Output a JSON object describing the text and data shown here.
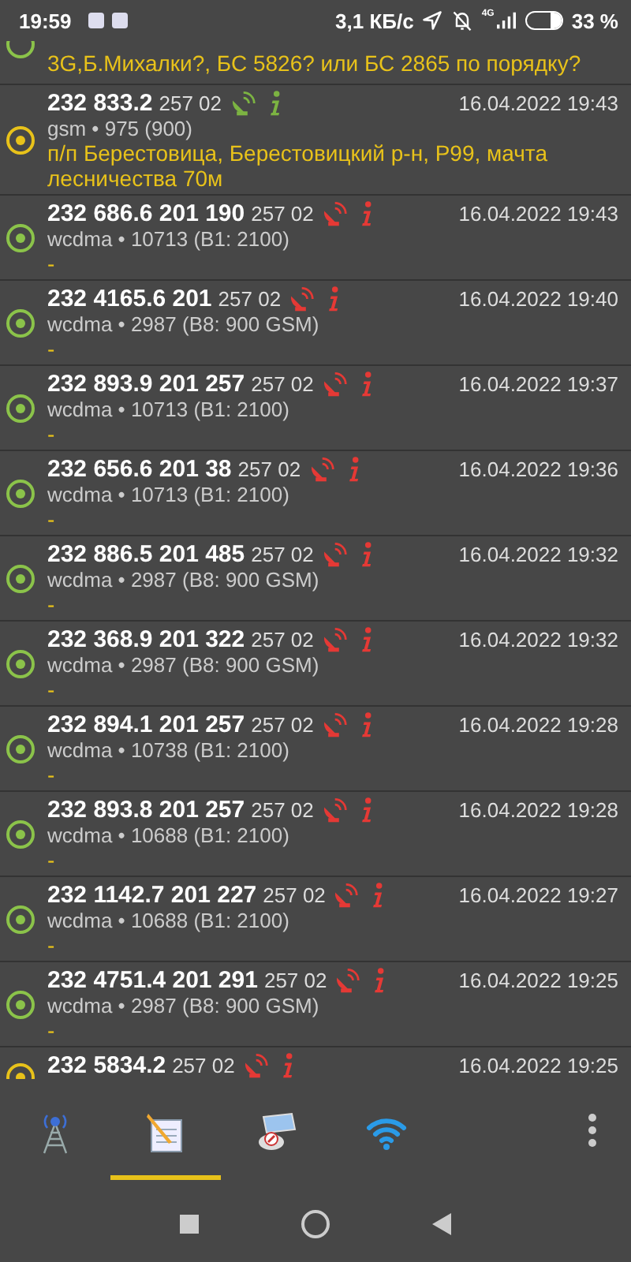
{
  "status_bar": {
    "time": "19:59",
    "speed": "3,1 КБ/с",
    "network": "4G",
    "battery": "33 %"
  },
  "log": [
    {
      "kind": "partial",
      "color": "#8bc34a",
      "note": "3G,Б.Михалки?, БС 5826? или БС 2865 по порядку?"
    },
    {
      "kind": "full",
      "title": "232 833.2",
      "code": "257 02",
      "located": true,
      "date": "16.04.2022 19:43",
      "tech": "gsm • 975 (900)",
      "note": "п/п Берестовица, Берестовицкий р-н, Р99, мачта лесничества 70м",
      "color": "#e8c21a"
    },
    {
      "kind": "full",
      "title": "232 686.6 201 190",
      "code": "257 02",
      "located": false,
      "date": "16.04.2022 19:43",
      "tech": "wcdma • 10713 (B1: 2100)",
      "note": "-",
      "color": "#8bc34a"
    },
    {
      "kind": "full",
      "title": "232 4165.6 201",
      "code": "257 02",
      "located": false,
      "date": "16.04.2022 19:40",
      "tech": "wcdma • 2987 (B8: 900 GSM)",
      "note": "-",
      "color": "#8bc34a"
    },
    {
      "kind": "full",
      "title": "232 893.9 201 257",
      "code": "257 02",
      "located": false,
      "date": "16.04.2022 19:37",
      "tech": "wcdma • 10713 (B1: 2100)",
      "note": "-",
      "color": "#8bc34a"
    },
    {
      "kind": "full",
      "title": "232 656.6 201 38",
      "code": "257 02",
      "located": false,
      "date": "16.04.2022 19:36",
      "tech": "wcdma • 10713 (B1: 2100)",
      "note": "-",
      "color": "#8bc34a"
    },
    {
      "kind": "full",
      "title": "232 886.5 201 485",
      "code": "257 02",
      "located": false,
      "date": "16.04.2022 19:32",
      "tech": "wcdma • 2987 (B8: 900 GSM)",
      "note": "-",
      "color": "#8bc34a"
    },
    {
      "kind": "full",
      "title": "232 368.9 201 322",
      "code": "257 02",
      "located": false,
      "date": "16.04.2022 19:32",
      "tech": "wcdma • 2987 (B8: 900 GSM)",
      "note": "-",
      "color": "#8bc34a"
    },
    {
      "kind": "full",
      "title": "232 894.1 201 257",
      "code": "257 02",
      "located": false,
      "date": "16.04.2022 19:28",
      "tech": "wcdma • 10738 (B1: 2100)",
      "note": "-",
      "color": "#8bc34a"
    },
    {
      "kind": "full",
      "title": "232 893.8 201 257",
      "code": "257 02",
      "located": false,
      "date": "16.04.2022 19:28",
      "tech": "wcdma • 10688 (B1: 2100)",
      "note": "-",
      "color": "#8bc34a"
    },
    {
      "kind": "full",
      "title": "232 1142.7 201 227",
      "code": "257 02",
      "located": false,
      "date": "16.04.2022 19:27",
      "tech": "wcdma • 10688 (B1: 2100)",
      "note": "-",
      "color": "#8bc34a"
    },
    {
      "kind": "full",
      "title": "232 4751.4 201 291",
      "code": "257 02",
      "located": false,
      "date": "16.04.2022 19:25",
      "tech": "wcdma • 2987 (B8: 900 GSM)",
      "note": "-",
      "color": "#8bc34a"
    },
    {
      "kind": "cut",
      "title": "232 5834.2",
      "code": "257 02",
      "located": false,
      "date": "16.04.2022 19:25",
      "color": "#e8c21a"
    }
  ],
  "tabs": [
    {
      "kind": "tower",
      "selected": false
    },
    {
      "kind": "notepad",
      "selected": true
    },
    {
      "kind": "map",
      "selected": false
    },
    {
      "kind": "wifi",
      "selected": false
    }
  ]
}
